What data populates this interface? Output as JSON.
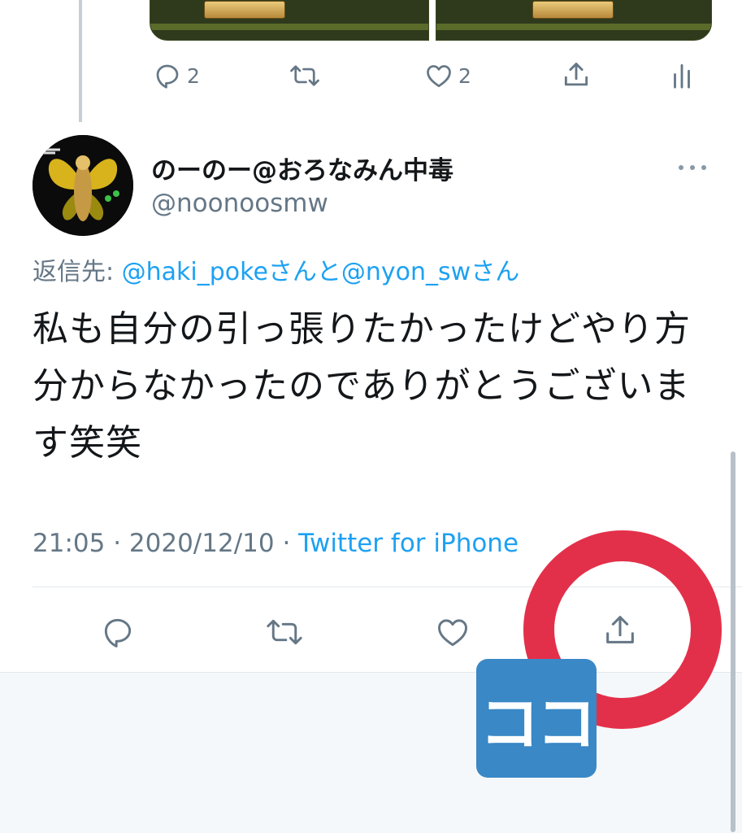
{
  "previous_tweet": {
    "reply_count": "2",
    "like_count": "2"
  },
  "tweet": {
    "display_name": "のーのー@おろなみん中毒",
    "handle": "@noonoosmw",
    "reply_to_label": "返信先: ",
    "reply_to_mentions": "@haki_pokeさんと@nyon_swさん",
    "text": "私も自分の引っ張りたかったけどやり方分からなかったのでありがとうございます笑笑",
    "time": "21:05",
    "separator": " · ",
    "date": "2020/12/10",
    "source": "Twitter for iPhone"
  },
  "annotation": {
    "label": "ココ",
    "ring_color": "#e3304a",
    "label_bg": "#3a88c6"
  },
  "icons": {
    "reply": "reply-icon",
    "retweet": "retweet-icon",
    "like": "heart-icon",
    "share": "share-icon",
    "analytics": "analytics-icon",
    "more": "more-icon"
  },
  "colors": {
    "link": "#1da1f2",
    "muted": "#657786",
    "text": "#14171a"
  }
}
